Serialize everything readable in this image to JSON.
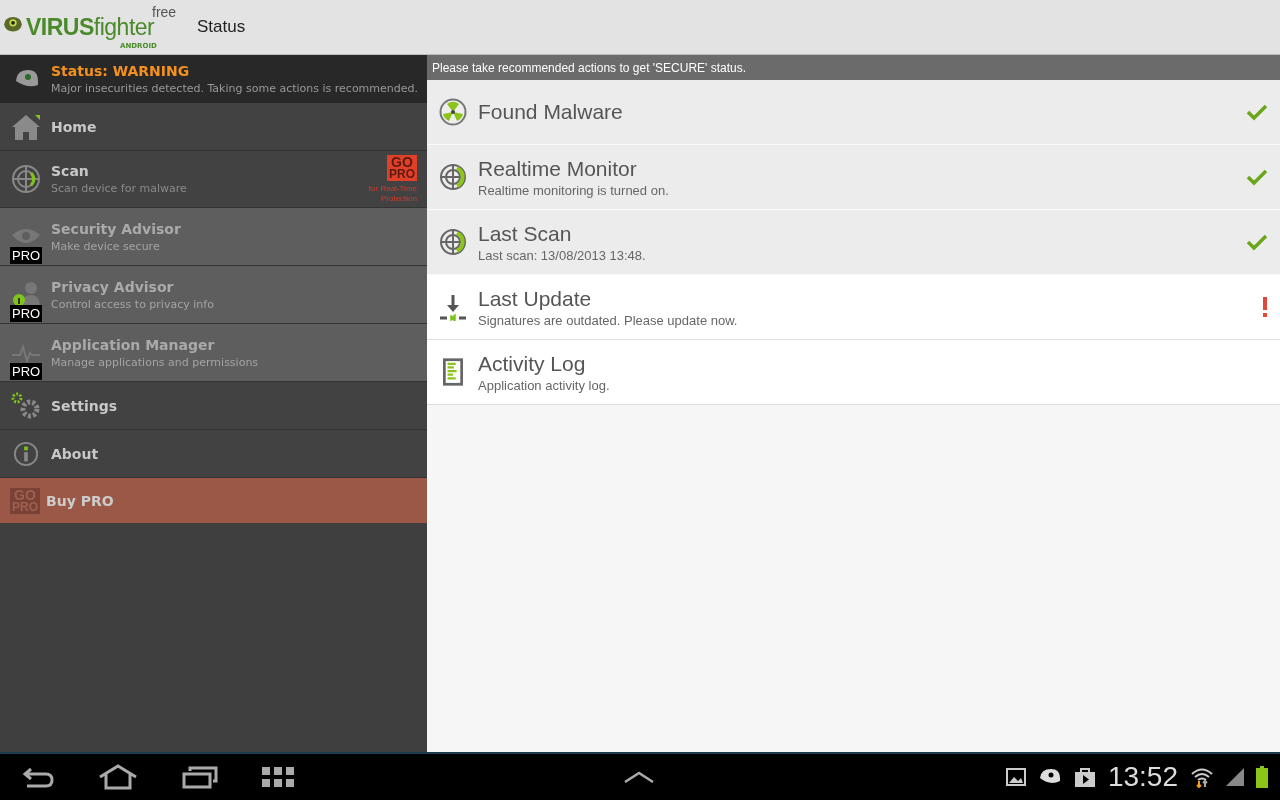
{
  "action_bar": {
    "logo": {
      "text": "**VIRUS**fighter",
      "edition": "free",
      "platform": "ANDROID"
    },
    "title": "Status"
  },
  "sidebar": {
    "status": {
      "title": "Status: WARNING",
      "message": "Major insecurities detected. Taking some actions is recommended."
    },
    "items": [
      {
        "kind": "home",
        "label": "Home",
        "pro_only": false
      },
      {
        "kind": "scan",
        "label": "Scan",
        "subtitle": "Scan device for malware",
        "pro_only": false,
        "promo": {
          "badge": [
            "GO",
            "PRO"
          ],
          "caption": [
            "for Real-Time",
            "Protection"
          ]
        }
      },
      {
        "kind": "eye",
        "label": "Security Advisor",
        "subtitle": "Make device secure",
        "pro_only": true,
        "pro_badge": "PRO"
      },
      {
        "kind": "person",
        "label": "Privacy Advisor",
        "subtitle": "Control access to privacy info",
        "pro_only": true,
        "pro_badge": "PRO"
      },
      {
        "kind": "pulse",
        "label": "Application Manager",
        "subtitle": "Manage applications and permissions",
        "pro_only": true,
        "pro_badge": "PRO"
      },
      {
        "kind": "gears",
        "label": "Settings",
        "pro_only": false
      },
      {
        "kind": "info",
        "label": "About",
        "pro_only": false
      }
    ],
    "buy": {
      "badge": [
        "GO",
        "PRO"
      ],
      "label": "Buy PRO"
    }
  },
  "main": {
    "banner": "Please take recommended actions to get 'SECURE' status.",
    "rows": [
      {
        "kind": "radiation",
        "title": "Found Malware",
        "checked": true,
        "alert": false
      },
      {
        "kind": "radar",
        "title": "Realtime Monitor",
        "subtitle": "Realtime monitoring is turned on.",
        "checked": true,
        "alert": false
      },
      {
        "kind": "radar",
        "title": "Last Scan",
        "subtitle": "Last scan: 13/08/2013 13:48.",
        "checked": true,
        "alert": false
      },
      {
        "kind": "download",
        "title": "Last Update",
        "subtitle": "Signatures are outdated. Please update now.",
        "checked": false,
        "alert": true
      },
      {
        "kind": "log",
        "title": "Activity Log",
        "subtitle": "Application activity log.",
        "checked": false,
        "alert": false
      }
    ]
  },
  "system_bar": {
    "clock": "13:52"
  }
}
